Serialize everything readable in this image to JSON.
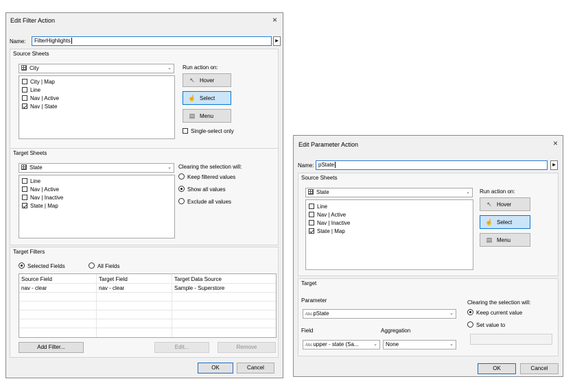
{
  "filter_dialog": {
    "title": "Edit Filter Action",
    "name_label": "Name:",
    "name_value": "FilterHighlights",
    "source": {
      "title": "Source Sheets",
      "datasource": "City",
      "sheets": [
        {
          "label": "City | Map",
          "checked": false
        },
        {
          "label": "Line",
          "checked": false
        },
        {
          "label": "Nav | Active",
          "checked": false
        },
        {
          "label": "Nav | State",
          "checked": true
        }
      ],
      "run_label": "Run action on:",
      "hover": "Hover",
      "select": "Select",
      "menu": "Menu",
      "single_select": "Single-select only"
    },
    "target": {
      "title": "Target Sheets",
      "datasource": "State",
      "sheets": [
        {
          "label": "Line",
          "checked": false
        },
        {
          "label": "Nav | Active",
          "checked": false
        },
        {
          "label": "Nav | Inactive",
          "checked": false
        },
        {
          "label": "State | Map",
          "checked": true
        }
      ],
      "clearing_label": "Clearing the selection will:",
      "options": [
        "Keep filtered values",
        "Show all values",
        "Exclude all values"
      ],
      "selected_option": 1
    },
    "filters": {
      "title": "Target Filters",
      "selected_fields": "Selected Fields",
      "all_fields": "All Fields",
      "columns": [
        "Source Field",
        "Target Field",
        "Target Data Source"
      ],
      "rows": [
        [
          "nav - clear",
          "nav - clear",
          "Sample - Superstore"
        ]
      ],
      "add_filter": "Add Filter...",
      "edit": "Edit...",
      "remove": "Remove"
    },
    "ok": "OK",
    "cancel": "Cancel",
    "close": "×"
  },
  "param_dialog": {
    "title": "Edit Parameter Action",
    "name_label": "Name:",
    "name_value": "pState",
    "source": {
      "title": "Source Sheets",
      "datasource": "State",
      "sheets": [
        {
          "label": "Line",
          "checked": false
        },
        {
          "label": "Nav | Active",
          "checked": false
        },
        {
          "label": "Nav | Inactive",
          "checked": false
        },
        {
          "label": "State | Map",
          "checked": true
        }
      ],
      "run_label": "Run action on:",
      "hover": "Hover",
      "select": "Select",
      "menu": "Menu"
    },
    "target": {
      "title": "Target",
      "parameter_label": "Parameter",
      "parameter_prefix": "Abc",
      "parameter_value": "pState",
      "field_label": "Field",
      "aggregation_label": "Aggregation",
      "field_prefix": "Abc",
      "field_value": "upper - state (Sa...",
      "aggregation_value": "None",
      "clearing_label": "Clearing the selection will:",
      "keep_current": "Keep current value",
      "set_value": "Set value to"
    },
    "ok": "OK",
    "cancel": "Cancel",
    "close": "×"
  },
  "icons": {
    "close": "close-icon",
    "datasource": "grid-icon",
    "hover": "pointer-icon",
    "select": "hand-pointer-icon",
    "menu": "menu-icon",
    "arrow": "triangle-right-icon"
  }
}
